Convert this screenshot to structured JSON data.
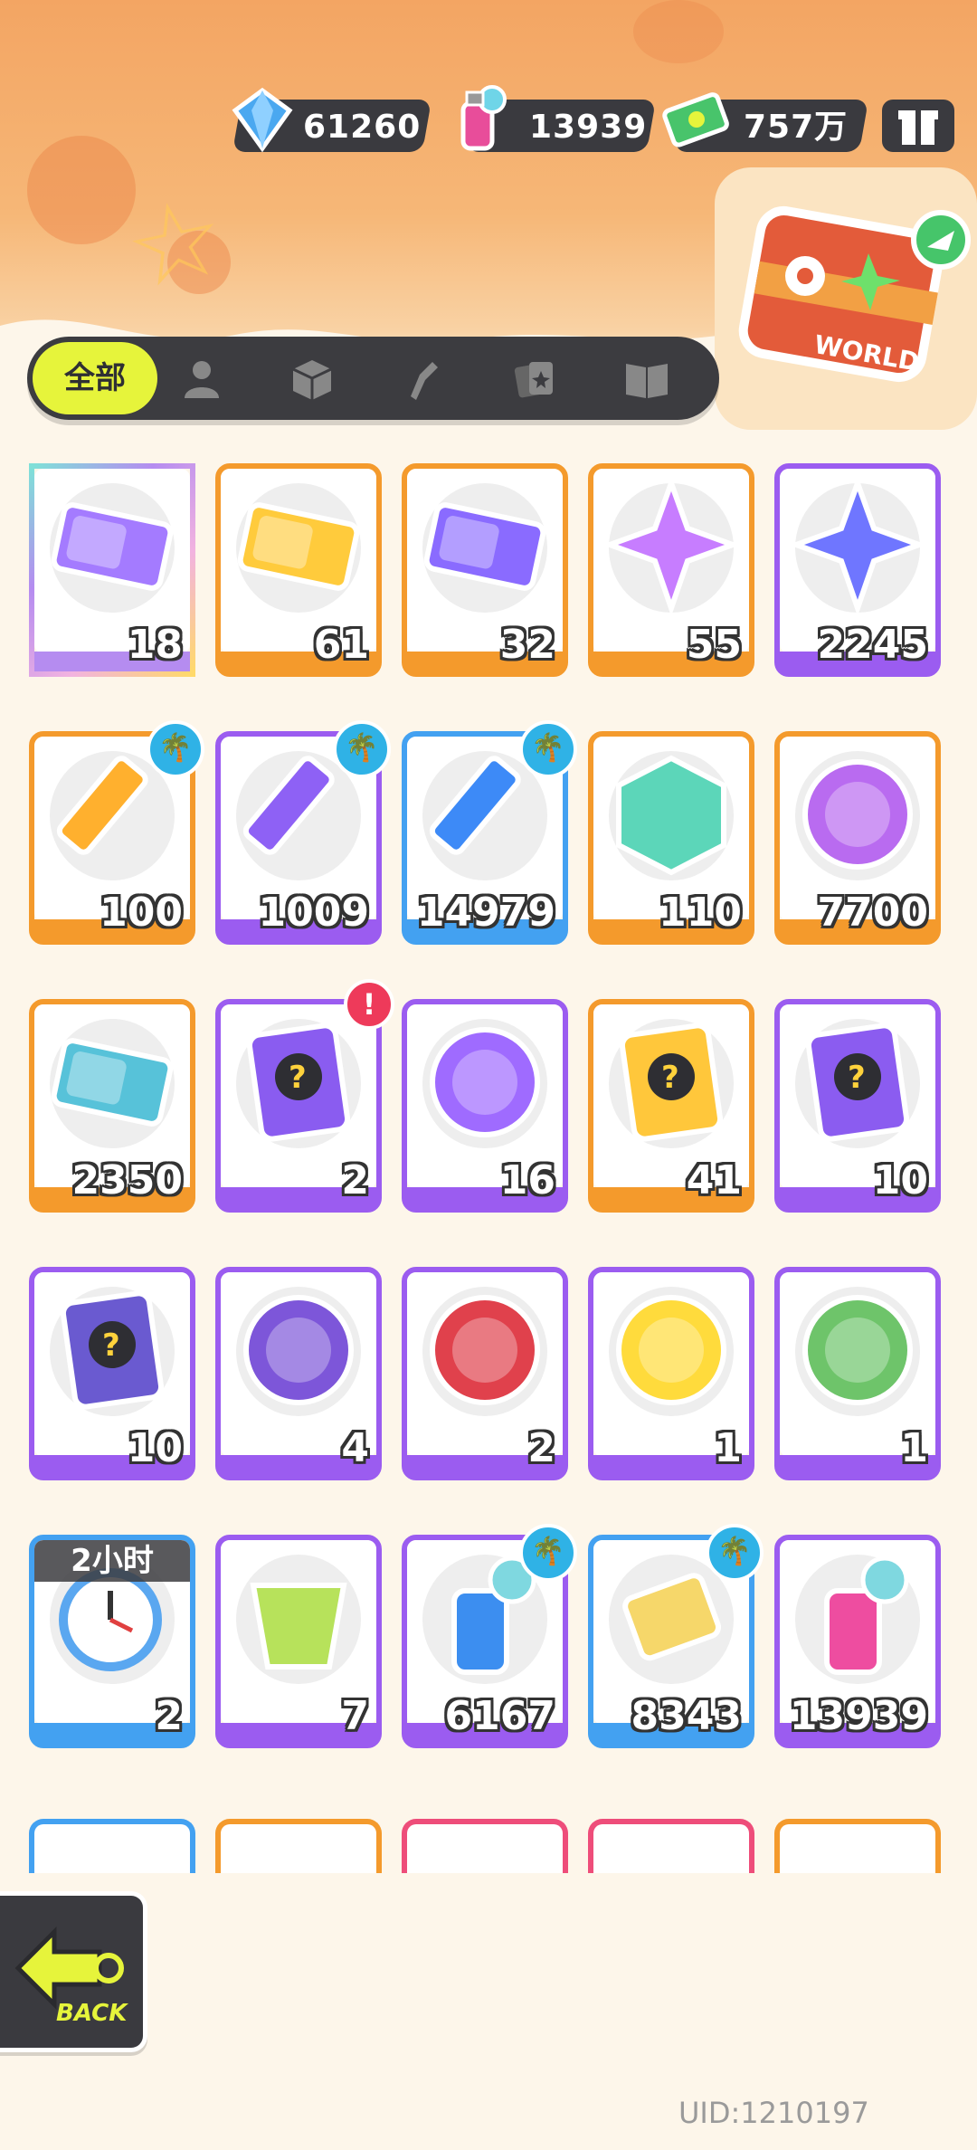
{
  "currencies": [
    {
      "name": "diamond-icon",
      "value": "61260",
      "color": "#4aa8f0"
    },
    {
      "name": "spray-can-icon",
      "value": "13939",
      "color": "#e84d9a"
    },
    {
      "name": "cash-icon",
      "value": "757万",
      "color": "#48c46b"
    }
  ],
  "tabs": {
    "active_label": "全部",
    "icons": [
      "person-icon",
      "box-icon",
      "brush-icon",
      "cards-icon",
      "book-icon"
    ]
  },
  "colors": {
    "orange": "#f49a2c",
    "purple": "#9b5cf0",
    "blue": "#43a1f1",
    "rainbow": "#f2b3e0",
    "tab_active": "#e6f43b",
    "dark": "#3a3a3f"
  },
  "items": [
    {
      "icon": "deity-ticket-icon",
      "count": "18",
      "frame": "rainbow"
    },
    {
      "icon": "gold-ticket-icon",
      "count": "61",
      "frame": "orange"
    },
    {
      "icon": "purple-ticket-icon",
      "count": "32",
      "frame": "orange"
    },
    {
      "icon": "rainbow-star-icon",
      "count": "55",
      "frame": "orange"
    },
    {
      "icon": "blue-star-icon",
      "count": "2245",
      "frame": "purple"
    },
    {
      "icon": "yellow-crayon-icon",
      "count": "100",
      "frame": "orange",
      "badge": "palm"
    },
    {
      "icon": "purple-crayon-icon",
      "count": "1009",
      "frame": "purple",
      "badge": "palm"
    },
    {
      "icon": "blue-crayon-icon",
      "count": "14979",
      "frame": "blue",
      "badge": "palm"
    },
    {
      "icon": "color-cube-icon",
      "count": "110",
      "frame": "orange"
    },
    {
      "icon": "cool-coin-icon",
      "count": "7700",
      "frame": "orange"
    },
    {
      "icon": "season-ticket-icon",
      "count": "2350",
      "frame": "orange"
    },
    {
      "icon": "travel-card-icon",
      "count": "2",
      "frame": "purple",
      "badge": "alert"
    },
    {
      "icon": "mystery-egg-icon",
      "count": "16",
      "frame": "purple"
    },
    {
      "icon": "deity-gold-mystery-icon",
      "count": "41",
      "frame": "orange"
    },
    {
      "icon": "deity-purple-mystery-icon",
      "count": "10",
      "frame": "purple"
    },
    {
      "icon": "travel-mystery-card-icon",
      "count": "10",
      "frame": "purple"
    },
    {
      "icon": "bat-pet-coin-icon",
      "count": "4",
      "frame": "purple"
    },
    {
      "icon": "fish-pet-coin-icon",
      "count": "2",
      "frame": "purple"
    },
    {
      "icon": "jelly-pet-coin-icon",
      "count": "1",
      "frame": "purple"
    },
    {
      "icon": "sprout-pet-coin-icon",
      "count": "1",
      "frame": "purple"
    },
    {
      "icon": "alarm-clock-icon",
      "count": "2",
      "frame": "blue",
      "timer": "2小时"
    },
    {
      "icon": "green-cup-icon",
      "count": "7",
      "frame": "purple"
    },
    {
      "icon": "blue-spray-icon",
      "count": "6167",
      "frame": "purple",
      "badge": "palm"
    },
    {
      "icon": "paint-tube-icon",
      "count": "8343",
      "frame": "blue",
      "badge": "palm"
    },
    {
      "icon": "pink-spray-icon",
      "count": "13939",
      "frame": "purple"
    }
  ],
  "badges": {
    "palm": "🌴",
    "alert": "!"
  },
  "peek_frames": [
    "blue",
    "orange",
    "pink",
    "pink",
    "orange"
  ],
  "back_button": {
    "label": "BACK"
  },
  "uid": "UID:1210197",
  "case_label": "WORLD"
}
